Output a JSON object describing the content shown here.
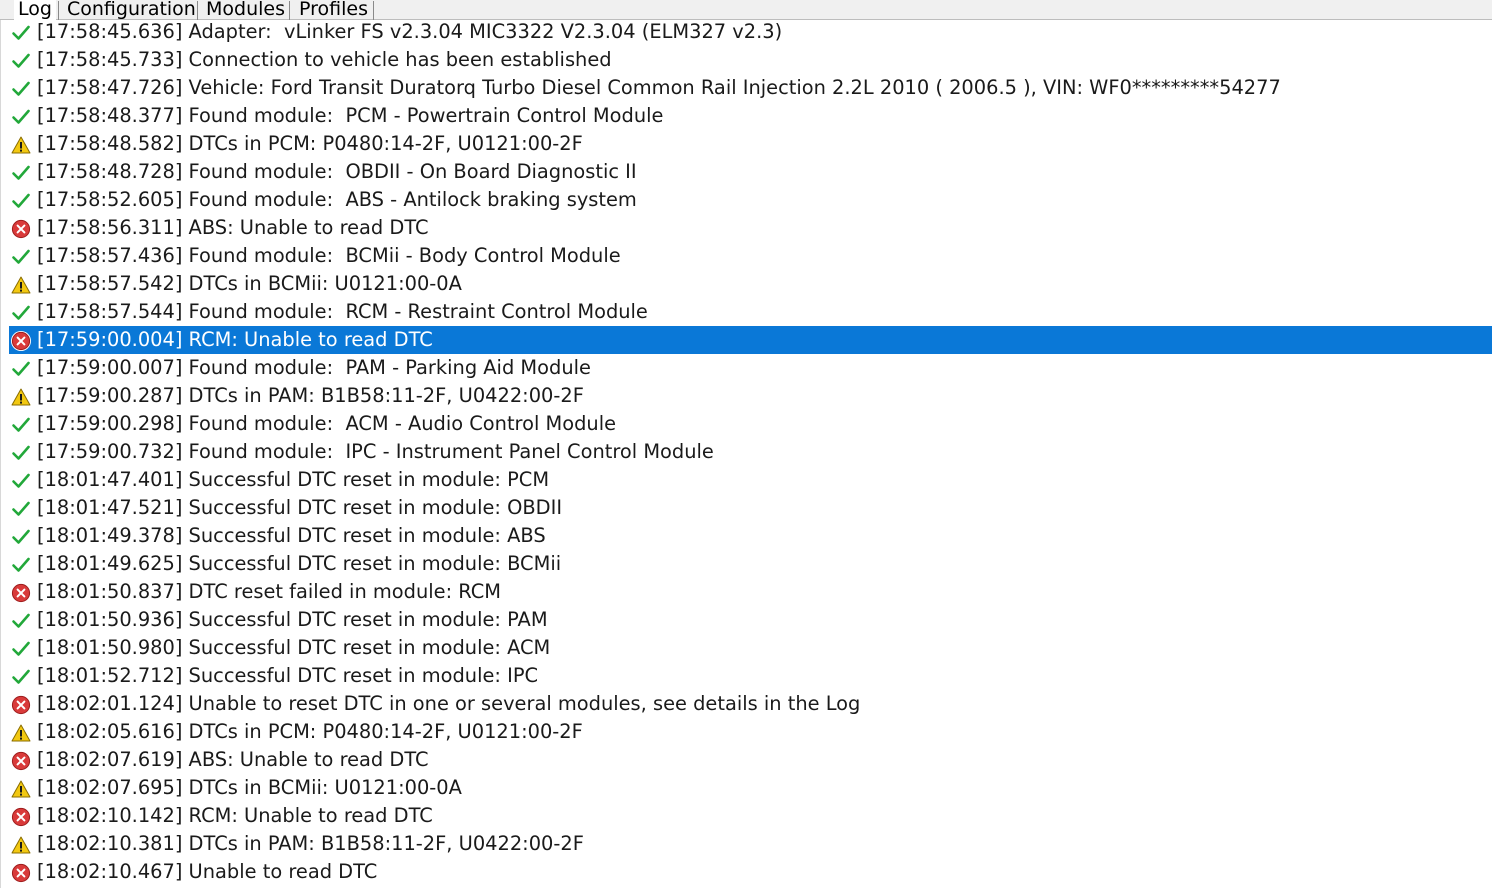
{
  "tabs": [
    {
      "label": "Log",
      "active": true
    },
    {
      "label": "Configuration",
      "active": false
    },
    {
      "label": "Modules",
      "active": false
    },
    {
      "label": "Profiles",
      "active": false
    }
  ],
  "colors": {
    "ok": "#22a83a",
    "warn_fill": "#f2c811",
    "error_fill": "#d93a3a",
    "selection": "#0a78d7"
  },
  "log": {
    "selected_index": 11,
    "entries": [
      {
        "status": "ok",
        "icon": "check-icon",
        "text": "[17:58:45.636] Adapter:  vLinker FS v2.3.04 MIC3322 V2.3.04 (ELM327 v2.3)"
      },
      {
        "status": "ok",
        "icon": "check-icon",
        "text": "[17:58:45.733] Connection to vehicle has been established"
      },
      {
        "status": "ok",
        "icon": "check-icon",
        "text": "[17:58:47.726] Vehicle: Ford Transit Duratorq Turbo Diesel Common Rail Injection 2.2L 2010 ( 2006.5 ), VIN: WF0*********54277"
      },
      {
        "status": "ok",
        "icon": "check-icon",
        "text": "[17:58:48.377] Found module:  PCM - Powertrain Control Module"
      },
      {
        "status": "warning",
        "icon": "warning-icon",
        "text": "[17:58:48.582] DTCs in PCM: P0480:14-2F, U0121:00-2F"
      },
      {
        "status": "ok",
        "icon": "check-icon",
        "text": "[17:58:48.728] Found module:  OBDII - On Board Diagnostic II"
      },
      {
        "status": "ok",
        "icon": "check-icon",
        "text": "[17:58:52.605] Found module:  ABS - Antilock braking system"
      },
      {
        "status": "error",
        "icon": "error-icon",
        "text": "[17:58:56.311] ABS: Unable to read DTC"
      },
      {
        "status": "ok",
        "icon": "check-icon",
        "text": "[17:58:57.436] Found module:  BCMii - Body Control Module"
      },
      {
        "status": "warning",
        "icon": "warning-icon",
        "text": "[17:58:57.542] DTCs in BCMii: U0121:00-0A"
      },
      {
        "status": "ok",
        "icon": "check-icon",
        "text": "[17:58:57.544] Found module:  RCM - Restraint Control Module"
      },
      {
        "status": "error",
        "icon": "error-icon",
        "text": "[17:59:00.004] RCM: Unable to read DTC"
      },
      {
        "status": "ok",
        "icon": "check-icon",
        "text": "[17:59:00.007] Found module:  PAM - Parking Aid Module"
      },
      {
        "status": "warning",
        "icon": "warning-icon",
        "text": "[17:59:00.287] DTCs in PAM: B1B58:11-2F, U0422:00-2F"
      },
      {
        "status": "ok",
        "icon": "check-icon",
        "text": "[17:59:00.298] Found module:  ACM - Audio Control Module"
      },
      {
        "status": "ok",
        "icon": "check-icon",
        "text": "[17:59:00.732] Found module:  IPC - Instrument Panel Control Module"
      },
      {
        "status": "ok",
        "icon": "check-icon",
        "text": "[18:01:47.401] Successful DTC reset in module: PCM"
      },
      {
        "status": "ok",
        "icon": "check-icon",
        "text": "[18:01:47.521] Successful DTC reset in module: OBDII"
      },
      {
        "status": "ok",
        "icon": "check-icon",
        "text": "[18:01:49.378] Successful DTC reset in module: ABS"
      },
      {
        "status": "ok",
        "icon": "check-icon",
        "text": "[18:01:49.625] Successful DTC reset in module: BCMii"
      },
      {
        "status": "error",
        "icon": "error-icon",
        "text": "[18:01:50.837] DTC reset failed in module: RCM"
      },
      {
        "status": "ok",
        "icon": "check-icon",
        "text": "[18:01:50.936] Successful DTC reset in module: PAM"
      },
      {
        "status": "ok",
        "icon": "check-icon",
        "text": "[18:01:50.980] Successful DTC reset in module: ACM"
      },
      {
        "status": "ok",
        "icon": "check-icon",
        "text": "[18:01:52.712] Successful DTC reset in module: IPC"
      },
      {
        "status": "error",
        "icon": "error-icon",
        "text": "[18:02:01.124] Unable to reset DTC in one or several modules, see details in the Log"
      },
      {
        "status": "warning",
        "icon": "warning-icon",
        "text": "[18:02:05.616] DTCs in PCM: P0480:14-2F, U0121:00-2F"
      },
      {
        "status": "error",
        "icon": "error-icon",
        "text": "[18:02:07.619] ABS: Unable to read DTC"
      },
      {
        "status": "warning",
        "icon": "warning-icon",
        "text": "[18:02:07.695] DTCs in BCMii: U0121:00-0A"
      },
      {
        "status": "error",
        "icon": "error-icon",
        "text": "[18:02:10.142] RCM: Unable to read DTC"
      },
      {
        "status": "warning",
        "icon": "warning-icon",
        "text": "[18:02:10.381] DTCs in PAM: B1B58:11-2F, U0422:00-2F"
      },
      {
        "status": "error",
        "icon": "error-icon",
        "text": "[18:02:10.467] Unable to read DTC"
      }
    ]
  }
}
